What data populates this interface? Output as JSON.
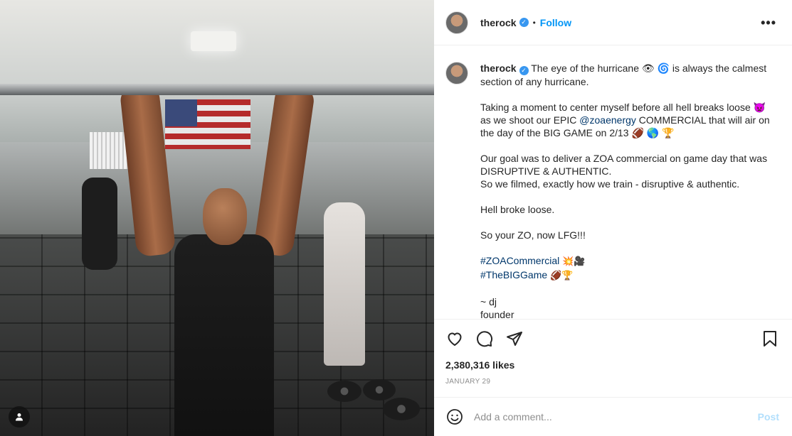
{
  "photo": {
    "alt_icon": "user-tag-icon"
  },
  "header": {
    "username": "therock",
    "verified_icon": "verified-badge-icon",
    "separator": "•",
    "follow_label": "Follow",
    "more_icon": "more-options-icon"
  },
  "caption": {
    "username": "therock",
    "line1": "The eye of the hurricane 👁 🌀 is always the calmest section of any hurricane.",
    "para2_a": "Taking a moment to center myself before all hell breaks loose 👿 as we shoot our EPIC ",
    "para2_mention": "@zoaenergy",
    "para2_b": " COMMERCIAL that will air on the day of the BIG GAME on 2/13 🏈 🌎 🏆",
    "para3": "Our goal was to deliver a ZOA commercial on game day that was DISRUPTIVE & AUTHENTIC.",
    "para3b": "So we filmed, exactly how we train - disruptive & authentic.",
    "para4": "Hell broke loose.",
    "para5": "So your ZO, now LFG!!!",
    "hashtag1": "#ZOACommercial",
    "hashtag1_emoji": "💥🎥",
    "hashtag2": "#TheBIGGame",
    "hashtag2_emoji": "🏈🏆",
    "sign1": "~ dj",
    "sign2": "founder"
  },
  "actions": {
    "like_icon": "heart-icon",
    "comment_icon": "comment-icon",
    "share_icon": "share-icon",
    "save_icon": "bookmark-icon",
    "likes": "2,380,316 likes",
    "date": "JANUARY 29"
  },
  "comment": {
    "emoji_icon": "emoji-icon",
    "placeholder": "Add a comment...",
    "post_label": "Post"
  },
  "colors": {
    "accent": "#0095f6",
    "post_disabled": "#b2dffc",
    "link": "#00376b"
  }
}
